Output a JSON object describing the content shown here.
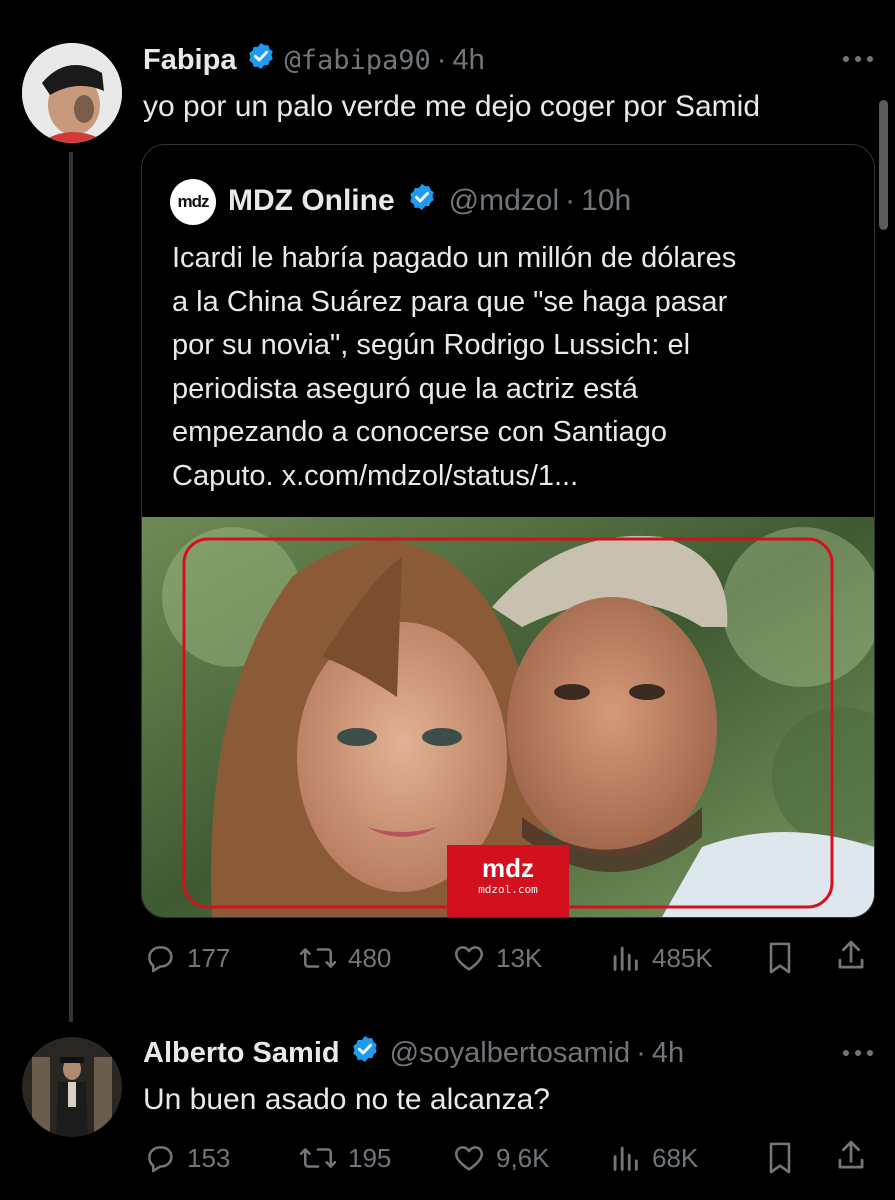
{
  "tweet1": {
    "display_name": "Fabipa",
    "handle": "@fabipa90",
    "time": "4h",
    "text": "yo por un palo verde me dejo coger por Samid",
    "quoted": {
      "logo_text": "mdz",
      "display_name": "MDZ Online",
      "handle": "@mdzol",
      "time": "10h",
      "text_lines": [
        "Icardi le habría pagado un millón de dólares",
        "a la China Suárez para que \"se haga pasar",
        "por su novia\", según Rodrigo Lussich: el",
        "periodista aseguró que la actriz está",
        "empezando a conocerse con Santiago",
        "Caputo. x.com/mdzol/status/1..."
      ],
      "image_badge": {
        "title": "mdz",
        "subtitle": "mdzol.com"
      }
    },
    "stats": {
      "replies": "177",
      "reposts": "480",
      "likes": "13K",
      "views": "485K"
    }
  },
  "tweet2": {
    "display_name": "Alberto Samid",
    "handle": "@soyalbertosamid",
    "time": "4h",
    "text": "Un buen asado no te alcanza?",
    "stats": {
      "replies": "153",
      "reposts": "195",
      "likes": "9,6K",
      "views": "68K"
    }
  },
  "colors": {
    "verified": "#1d9bf0",
    "muted": "#71767b",
    "brand_red": "#d3111e"
  }
}
